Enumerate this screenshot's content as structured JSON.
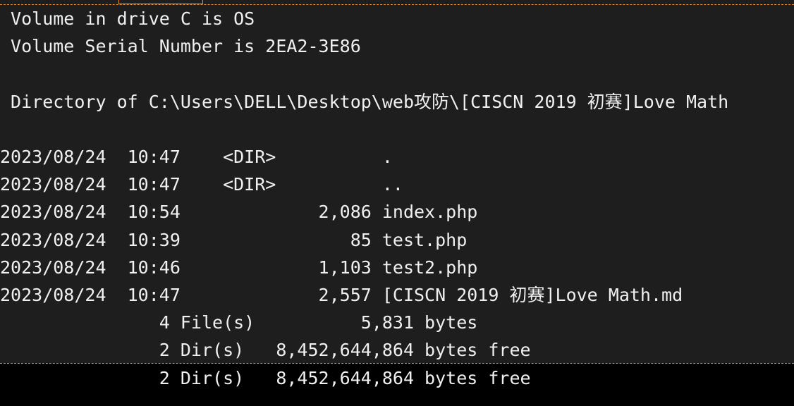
{
  "console": {
    "volume_label": " Volume in drive C is OS",
    "serial_number": " Volume Serial Number is 2EA2-3E86",
    "directory_header": " Directory of C:\\Users\\DELL\\Desktop\\web攻防\\[CISCN 2019 初赛]Love Math",
    "entries": [
      "2023/08/24  10:47    <DIR>          .",
      "2023/08/24  10:47    <DIR>          ..",
      "2023/08/24  10:54             2,086 index.php",
      "2023/08/24  10:39                85 test.php",
      "2023/08/24  10:46             1,103 test2.php",
      "2023/08/24  10:47             2,557 [CISCN 2019 初赛]Love Math.md"
    ],
    "file_summary": "               4 File(s)          5,831 bytes",
    "dir_summary": "               2 Dir(s)   8,452,644,864 bytes free",
    "dir_summary_repeat": "               2 Dir(s)   8,452,644,864 bytes free"
  }
}
